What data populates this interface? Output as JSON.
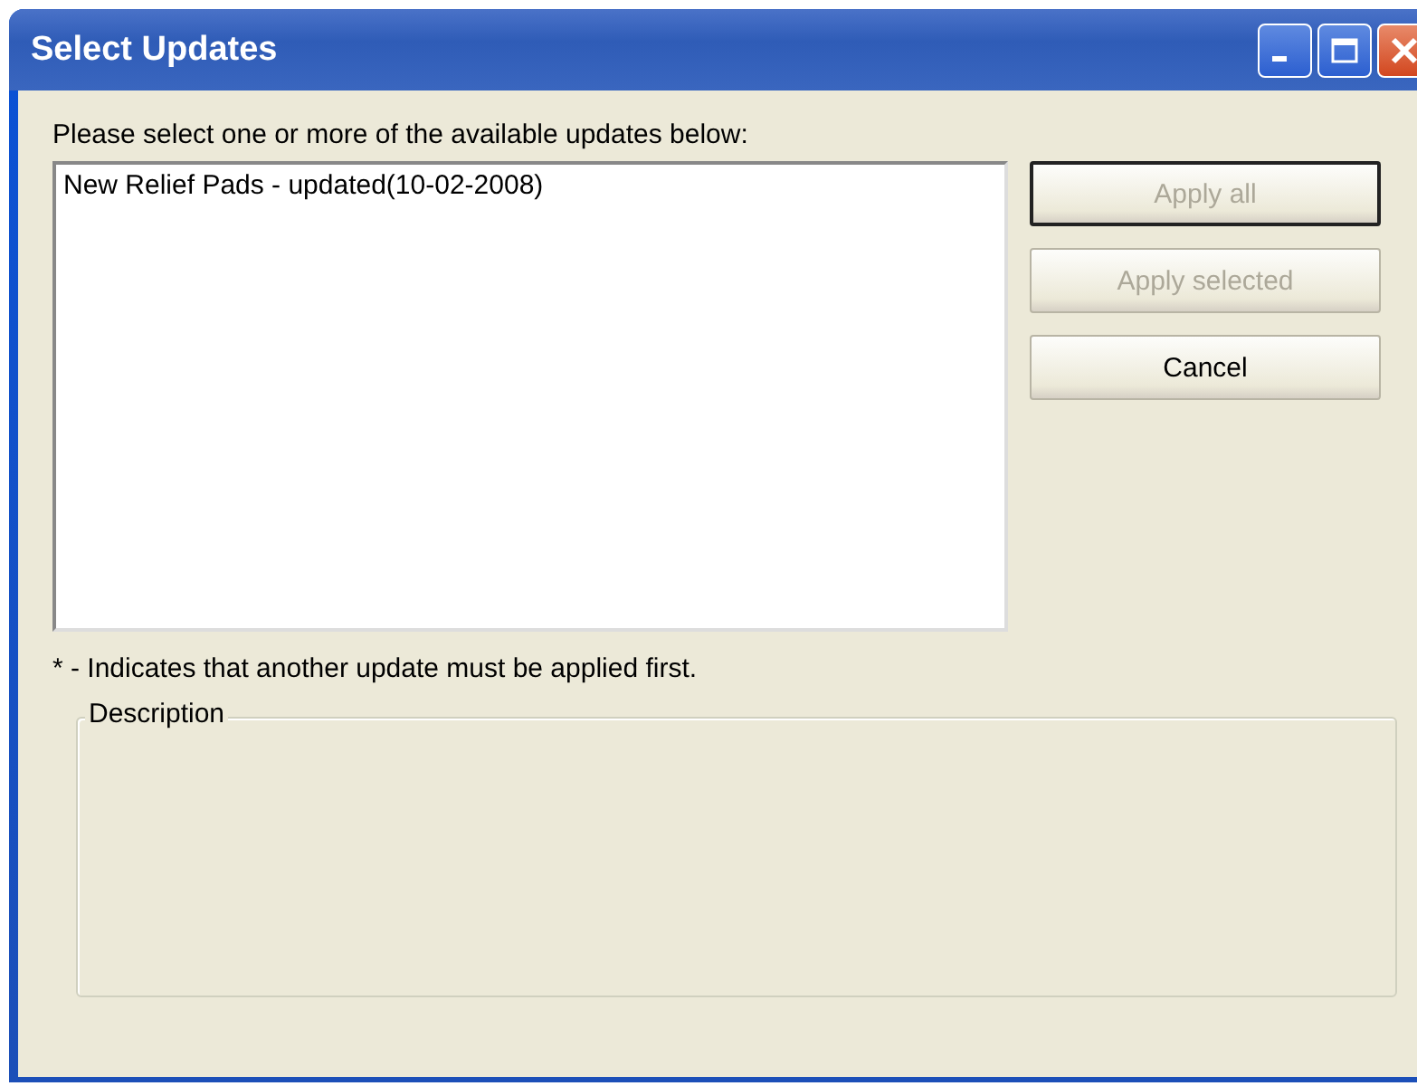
{
  "window": {
    "title": "Select Updates"
  },
  "prompt": "Please select one or more of the available updates below:",
  "updates": [
    {
      "label": "New Relief Pads - updated(10-02-2008)",
      "selected": false
    }
  ],
  "buttons": [
    {
      "label": "Apply all",
      "disabled": true,
      "default": true
    },
    {
      "label": "Apply selected",
      "disabled": true,
      "default": false
    },
    {
      "label": "Cancel",
      "disabled": false,
      "default": false
    }
  ],
  "footnote": "* - Indicates that another update must be applied first.",
  "description": {
    "label": "Description"
  }
}
